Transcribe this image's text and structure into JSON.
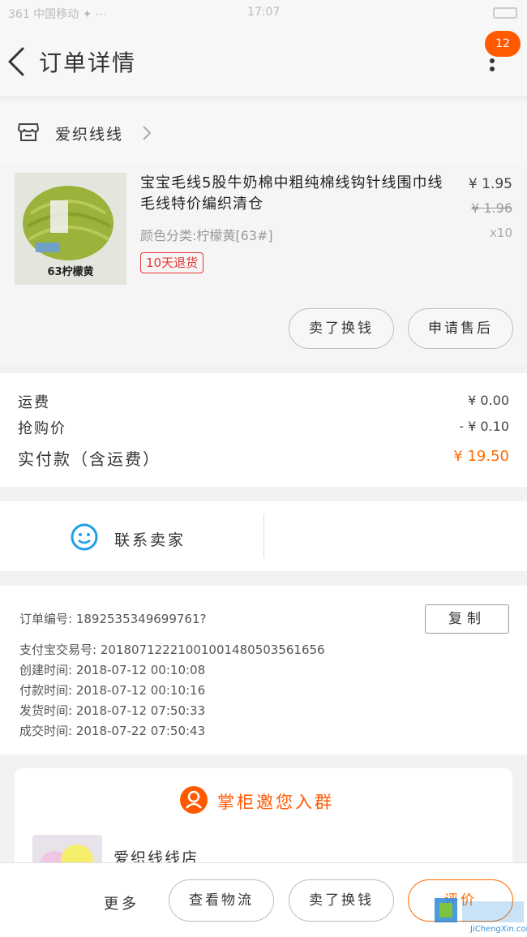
{
  "status_bar": {
    "left": "361 中国移动 ✦ ⋯",
    "center": "17:07"
  },
  "nav": {
    "title": "订单详情",
    "badge": "12",
    "back_icon": "chevron-left-icon",
    "more_icon": "more-vertical-icon"
  },
  "shop": {
    "name": "爱织线线",
    "icon": "store-icon"
  },
  "item": {
    "title": "宝宝毛线5股牛奶棉中粗纯棉线钩针线围巾线毛线特价编织清仓",
    "price": "¥ 1.95",
    "original_price": "¥ 1.96",
    "quantity": "x10",
    "sku": "颜色分类:柠檬黄[63#]",
    "tag": "10天退货",
    "thumb_label": "63柠檬黄",
    "thumb_color": "#9bb33a",
    "buttons": [
      "卖了换钱",
      "申请售后"
    ]
  },
  "fees": [
    {
      "label": "运费",
      "value": "¥ 0.00"
    },
    {
      "label": "抢购价",
      "value": "- ¥ 0.10"
    },
    {
      "label": "实付款（含运费）",
      "value": "¥ 19.50"
    }
  ],
  "contact": {
    "label": "联系卖家",
    "icon": "smile-chat-icon",
    "icon_color": "#1e9fe8"
  },
  "order_info": {
    "order_no": "订单编号:  1892535349699761?",
    "alipay_no": "支付宝交易号:  20180712221001001480503561656",
    "created": "创建时间:  2018-07-12 00:10:08",
    "paid": "付款时间:  2018-07-12 00:10:16",
    "shipped": "发货时间:  2018-07-12 07:50:33",
    "completed": "成交时间:  2018-07-22 07:50:43",
    "copy_label": "复制"
  },
  "group": {
    "title": "掌柜邀您入群",
    "shop": "爱织线线店",
    "accent": "#ff5a00"
  },
  "bottom_bar": {
    "more": "更多",
    "logistics": "查看物流",
    "resell": "卖了换钱",
    "review": "评价"
  },
  "watermark": {
    "text": "JiChengXin.com"
  }
}
